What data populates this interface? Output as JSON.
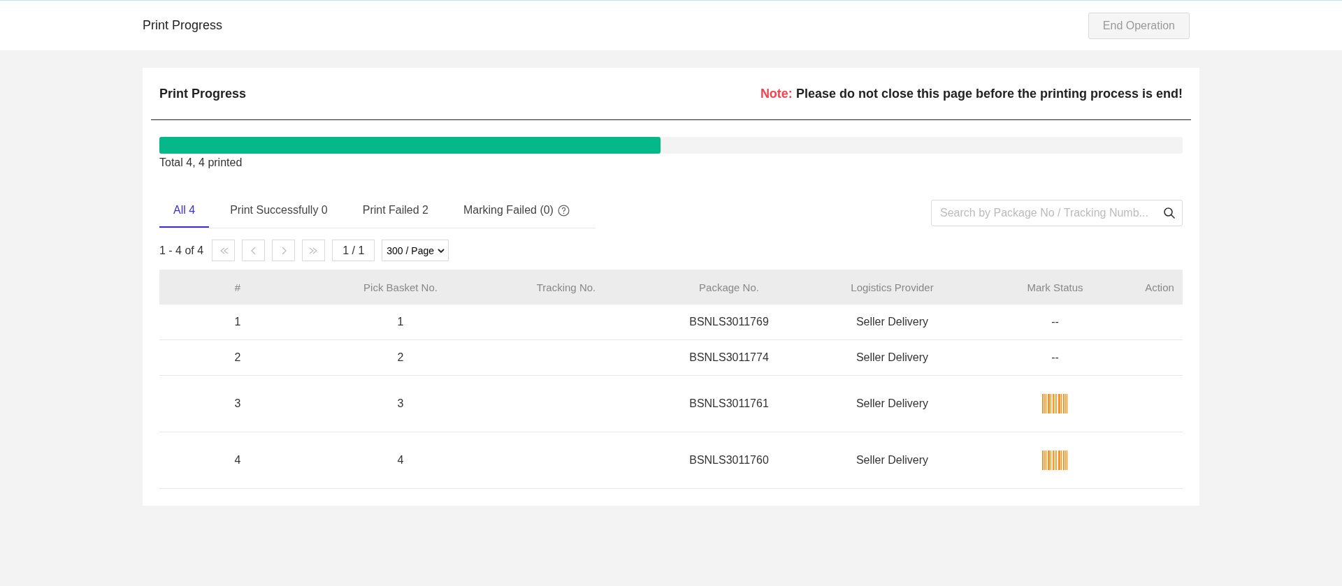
{
  "header": {
    "title": "Print Progress",
    "end_button": {
      "label": "End Operation",
      "disabled": true
    }
  },
  "card": {
    "title": "Print Progress",
    "note_label": "Note:",
    "note_text": "Please do not close this page before the printing process is end!",
    "progress": {
      "level": 0.49,
      "caption": "Total 4, 4 printed"
    },
    "tabs": [
      {
        "label": "All 4",
        "selected": true,
        "help": false
      },
      {
        "label": "Print Successfully 0",
        "selected": false,
        "help": false
      },
      {
        "label": "Print Failed 2",
        "selected": false,
        "help": false
      },
      {
        "label": "Marking Failed (0)",
        "selected": false,
        "help": true
      }
    ],
    "search": {
      "placeholder": "Search by Package No / Tracking Numb..."
    },
    "pagination": {
      "range": "1 - 4 of 4",
      "page": "1 / 1",
      "page_size": "300 / Page"
    },
    "table": {
      "columns": [
        "#",
        "Pick Basket No.",
        "Tracking No.",
        "Package No.",
        "Logistics Provider",
        "Mark Status",
        "Action"
      ],
      "rows": [
        {
          "cells": [
            "1",
            "1",
            "",
            "BSNLS3011769",
            "Seller Delivery"
          ],
          "mark": {
            "kind": "text",
            "text": "--"
          }
        },
        {
          "cells": [
            "2",
            "2",
            "",
            "BSNLS3011774",
            "Seller Delivery"
          ],
          "mark": {
            "kind": "text",
            "text": "--"
          }
        },
        {
          "cells": [
            "3",
            "3",
            "",
            "BSNLS3011761",
            "Seller Delivery"
          ],
          "mark": {
            "kind": "barcode"
          }
        },
        {
          "cells": [
            "4",
            "4",
            "",
            "BSNLS3011760",
            "Seller Delivery"
          ],
          "mark": {
            "kind": "barcode"
          }
        }
      ]
    }
  }
}
